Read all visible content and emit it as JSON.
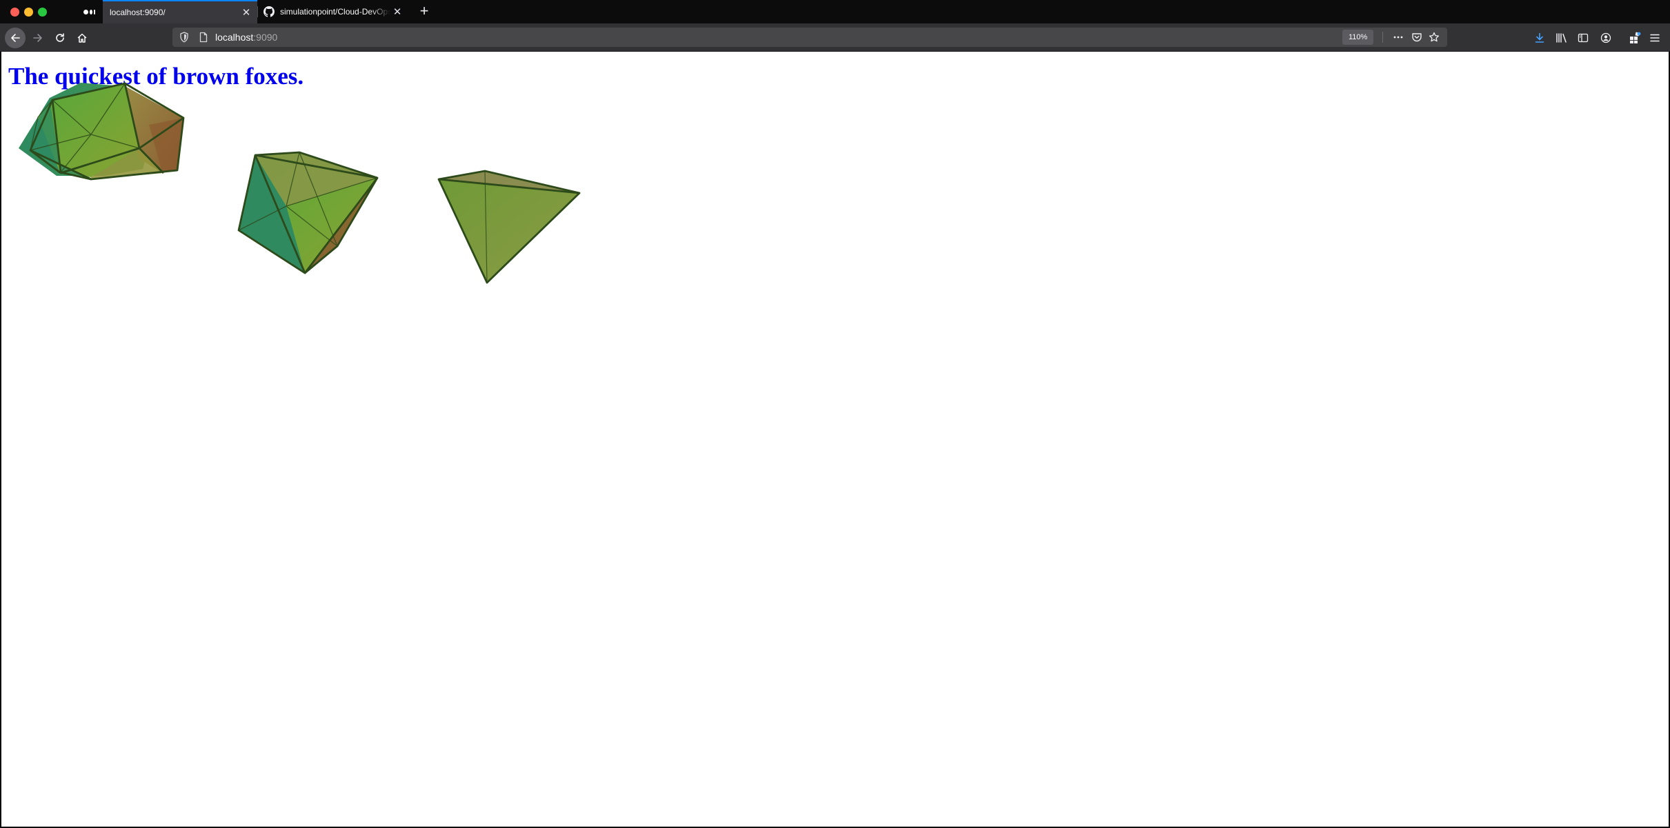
{
  "browser": {
    "tabs": [
      {
        "title": "",
        "pinned": true,
        "icon": "medium-icon"
      },
      {
        "title": "localhost:9090/",
        "active": true
      },
      {
        "title": "simulationpoint/Cloud-DevOps",
        "icon": "github-icon"
      }
    ],
    "url_host": "localhost",
    "url_port": ":9090",
    "zoom": "110%",
    "accent_color": "#0a84ff"
  },
  "page": {
    "heading": "The quickest of brown foxes.",
    "heading_color": "#0000ee",
    "shapes": [
      "icosahedron",
      "octahedron",
      "tetrahedron"
    ]
  }
}
